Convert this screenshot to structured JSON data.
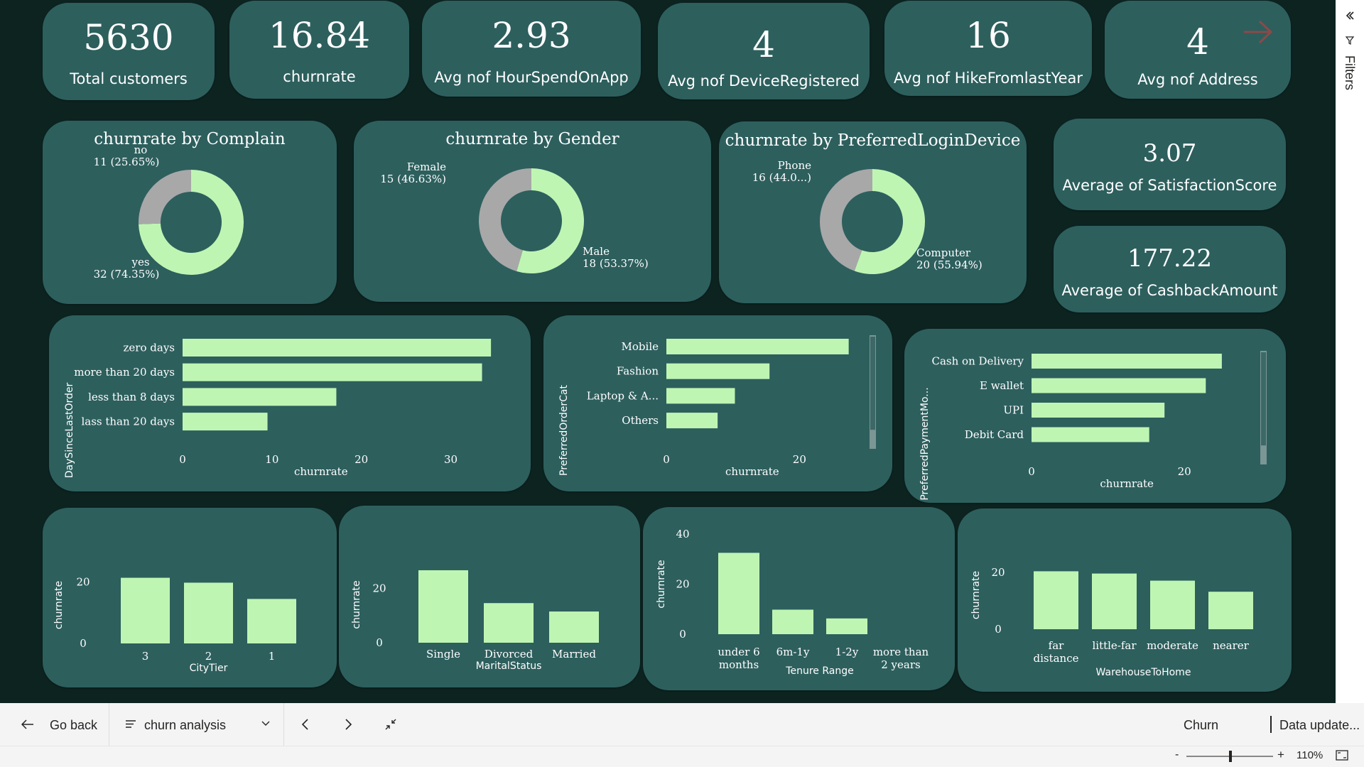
{
  "kpis": [
    {
      "value": "5630",
      "label": "Total customers"
    },
    {
      "value": "16.84",
      "label": "churnrate"
    },
    {
      "value": "2.93",
      "label": "Avg nof HourSpendOnApp"
    },
    {
      "value": "4",
      "label": "Avg nof DeviceRegistered"
    },
    {
      "value": "16",
      "label": "Avg nof HikeFromlastYear"
    },
    {
      "value": "4",
      "label": "Avg nof Address"
    }
  ],
  "side_kpis": [
    {
      "value": "3.07",
      "label": "Average of SatisfactionScore"
    },
    {
      "value": "177.22",
      "label": "Average of CashbackAmount"
    }
  ],
  "colors": {
    "accent": "#bff5b3",
    "grey": "#a8a8a8",
    "card": "#2d5f5d",
    "background": "#0c2320"
  },
  "chart_data": [
    {
      "type": "pie",
      "title": "churnrate by Complain",
      "donut": true,
      "slices": [
        {
          "name": "no",
          "value": 11,
          "label": "11 (25.65%)"
        },
        {
          "name": "yes",
          "value": 32,
          "label": "32 (74.35%)"
        }
      ]
    },
    {
      "type": "pie",
      "title": "churnrate by Gender",
      "donut": true,
      "slices": [
        {
          "name": "Female",
          "value": 15,
          "label": "15 (46.63%)"
        },
        {
          "name": "Male",
          "value": 18,
          "label": "18 (53.37%)"
        }
      ]
    },
    {
      "type": "pie",
      "title": "churnrate by PreferredLoginDevice",
      "donut": true,
      "slices": [
        {
          "name": "Phone",
          "value": 16,
          "label": "16 (44.0...)"
        },
        {
          "name": "Computer",
          "value": 20,
          "label": "20 (55.94%)"
        }
      ]
    },
    {
      "type": "bar",
      "orientation": "horizontal",
      "categories": [
        "zero days",
        "more than 20 days",
        "less than 8 days",
        "lass than 20 days"
      ],
      "values": [
        34.5,
        33.5,
        17.2,
        9.5
      ],
      "xlabel": "churnrate",
      "ylabel": "DaySinceLastOrder",
      "xticks": [
        "0",
        "10",
        "20",
        "30"
      ],
      "xlim": [
        0,
        36
      ]
    },
    {
      "type": "bar",
      "orientation": "horizontal",
      "categories": [
        "Mobile",
        "Fashion",
        "Laptop & A..."
      ],
      "extra_category": "Others",
      "values": [
        27.4,
        15.5,
        10.3,
        7.7
      ],
      "xlabel": "churnrate",
      "ylabel": "PreferredOrderCat",
      "xticks": [
        "0",
        "20"
      ],
      "xlim": [
        0,
        30
      ]
    },
    {
      "type": "bar",
      "orientation": "horizontal",
      "categories": [
        "Cash on Delivery",
        "E wallet",
        "UPI",
        "Debit Card"
      ],
      "values": [
        24.9,
        22.8,
        17.4,
        15.4
      ],
      "xlabel": "churnrate",
      "ylabel": "PreferredPaymentMo...",
      "xticks": [
        "0",
        "20"
      ],
      "xlim": [
        0,
        29
      ]
    },
    {
      "type": "bar",
      "categories": [
        "3",
        "2",
        "1"
      ],
      "values": [
        21.4,
        19.8,
        14.5
      ],
      "xlabel": "CityTier",
      "ylabel": "churnrate",
      "yticks": [
        "0",
        "20"
      ],
      "ylim": [
        0,
        25
      ]
    },
    {
      "type": "bar",
      "categories": [
        "Single",
        "Divorced",
        "Married"
      ],
      "values": [
        26.7,
        14.6,
        11.5
      ],
      "xlabel": "MaritalStatus",
      "ylabel": "churnrate",
      "yticks": [
        "0",
        "20"
      ],
      "ylim": [
        0,
        28
      ]
    },
    {
      "type": "bar",
      "categories": [
        "under 6 months",
        "6m-1y",
        "1-2y",
        "more than 2 years"
      ],
      "values": [
        32.5,
        9.8,
        6.3,
        0
      ],
      "xlabel": "Tenure Range",
      "ylabel": "churnrate",
      "yticks": [
        "0",
        "20",
        "40"
      ],
      "ylim": [
        0,
        40
      ]
    },
    {
      "type": "bar",
      "categories": [
        "far distance",
        "little-far",
        "moderate",
        "nearer"
      ],
      "values": [
        20.4,
        19.6,
        17.1,
        13.2
      ],
      "xlabel": "WarehouseToHome",
      "ylabel": "churnrate",
      "yticks": [
        "0",
        "20"
      ],
      "ylim": [
        0,
        24
      ]
    }
  ],
  "right_pane": {
    "label": "Filters"
  },
  "bottom_bar": {
    "go_back": "Go back",
    "page_name": "churn analysis",
    "report_name": "Churn",
    "data_update": "Data update...",
    "zoom": "110%",
    "zoom_minus": "-",
    "zoom_plus": "+"
  }
}
